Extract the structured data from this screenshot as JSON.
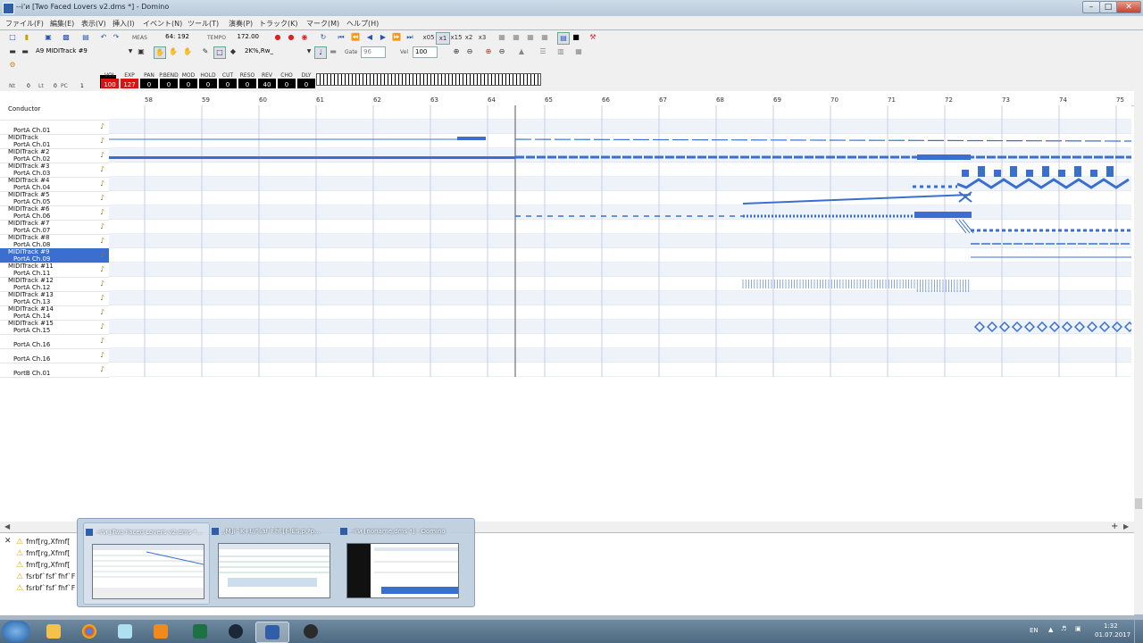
{
  "window": {
    "title": "--i'и [Two Faced Lovers v2.dms *] - Domino",
    "minimize_icon": "minimize-icon",
    "maximize_icon": "maximize-icon",
    "close_icon": "close-icon"
  },
  "menu": [
    "ファイル(F)",
    "編集(E)",
    "表示(V)",
    "挿入(I)",
    "イベント(N)",
    "ツール(T)",
    "演奏(P)",
    "トラック(K)",
    "マーク(M)",
    "ヘルプ(H)"
  ],
  "toolbar1": {
    "meas_label": "MEAS",
    "position": "64: 192",
    "tempo_label": "TEMPO",
    "tempo": "172.00",
    "speed_buttons": [
      "x05",
      "x1",
      "x15",
      "x2",
      "x3"
    ]
  },
  "toolbar2": {
    "track_select": "A9 MIDITrack #9",
    "note_select": "2K%,Rw_",
    "gate_label": "Gate",
    "gate_value": "96",
    "vel_label": "Vel",
    "vel_value": "100"
  },
  "mixer": {
    "left_labels": [
      "Nt",
      "0",
      "Lt",
      "0",
      "PC",
      "1"
    ],
    "channels": [
      {
        "label": "VOL",
        "value": "100"
      },
      {
        "label": "EXP",
        "value": "127"
      },
      {
        "label": "PAN",
        "value": "0"
      },
      {
        "label": "P.BEND",
        "value": "0"
      },
      {
        "label": "MOD",
        "value": "0"
      },
      {
        "label": "HOLD",
        "value": "0"
      },
      {
        "label": "CUT",
        "value": "0"
      },
      {
        "label": "RESO",
        "value": "0"
      },
      {
        "label": "REV",
        "value": "40"
      },
      {
        "label": "CHO",
        "value": "0"
      },
      {
        "label": "DLY",
        "value": "0"
      }
    ]
  },
  "ruler": {
    "measures": [
      "58",
      "59",
      "60",
      "61",
      "62",
      "63",
      "64",
      "65",
      "66",
      "67",
      "68",
      "69",
      "70",
      "71",
      "72",
      "73",
      "74",
      "75"
    ]
  },
  "tracks": [
    {
      "name": "Conductor",
      "port": ""
    },
    {
      "name": "",
      "port": "PortA  Ch.01"
    },
    {
      "name": "MIDITrack",
      "port": "PortA  Ch.01"
    },
    {
      "name": "MIDITrack #2",
      "port": "PortA  Ch.02"
    },
    {
      "name": "MIDITrack #3",
      "port": "PortA  Ch.03"
    },
    {
      "name": "MIDITrack #4",
      "port": "PortA  Ch.04"
    },
    {
      "name": "MIDITrack #5",
      "port": "PortA  Ch.05"
    },
    {
      "name": "MIDITrack #6",
      "port": "PortA  Ch.06"
    },
    {
      "name": "MIDITrack #7",
      "port": "PortA  Ch.07"
    },
    {
      "name": "MIDITrack #8",
      "port": "PortA  Ch.08"
    },
    {
      "name": "MIDITrack #9",
      "port": "PortA  Ch.09"
    },
    {
      "name": "MIDITrack #11",
      "port": "PortA  Ch.11"
    },
    {
      "name": "MIDITrack #12",
      "port": "PortA  Ch.12"
    },
    {
      "name": "MIDITrack #13",
      "port": "PortA  Ch.13"
    },
    {
      "name": "MIDITrack #14",
      "port": "PortA  Ch.14"
    },
    {
      "name": "MIDITrack #15",
      "port": "PortA  Ch.15"
    },
    {
      "name": "",
      "port": "PortA  Ch.16"
    },
    {
      "name": "",
      "port": "PortA  Ch.16"
    },
    {
      "name": "",
      "port": "PortB  Ch.01"
    }
  ],
  "log": [
    "fmf[rg,Xfmf[",
    "fmf[rg,Xfmf[",
    "fmf[rg,Xfmf[",
    "fsrbf`fsf`fhf`F",
    "fsrbf`fsf`fhf`F"
  ],
  "thumbnails": [
    {
      "title": "--i'и [Two Faced Lovers v2.dms *..."
    },
    {
      "title": ",,M]i^K+f//%af`f'hf'[f-fES,p,ªp..."
    },
    {
      "title": "--i'и [noname.dms *] - Domino"
    }
  ],
  "taskbar": {
    "lang": "EN",
    "time": "1:32",
    "date": "01.07.2017",
    "apps": [
      "folder-icon",
      "chrome-icon",
      "notepad-icon",
      "media-player-icon",
      "excel-icon",
      "steam-icon",
      "domino-icon",
      "obs-icon"
    ]
  }
}
